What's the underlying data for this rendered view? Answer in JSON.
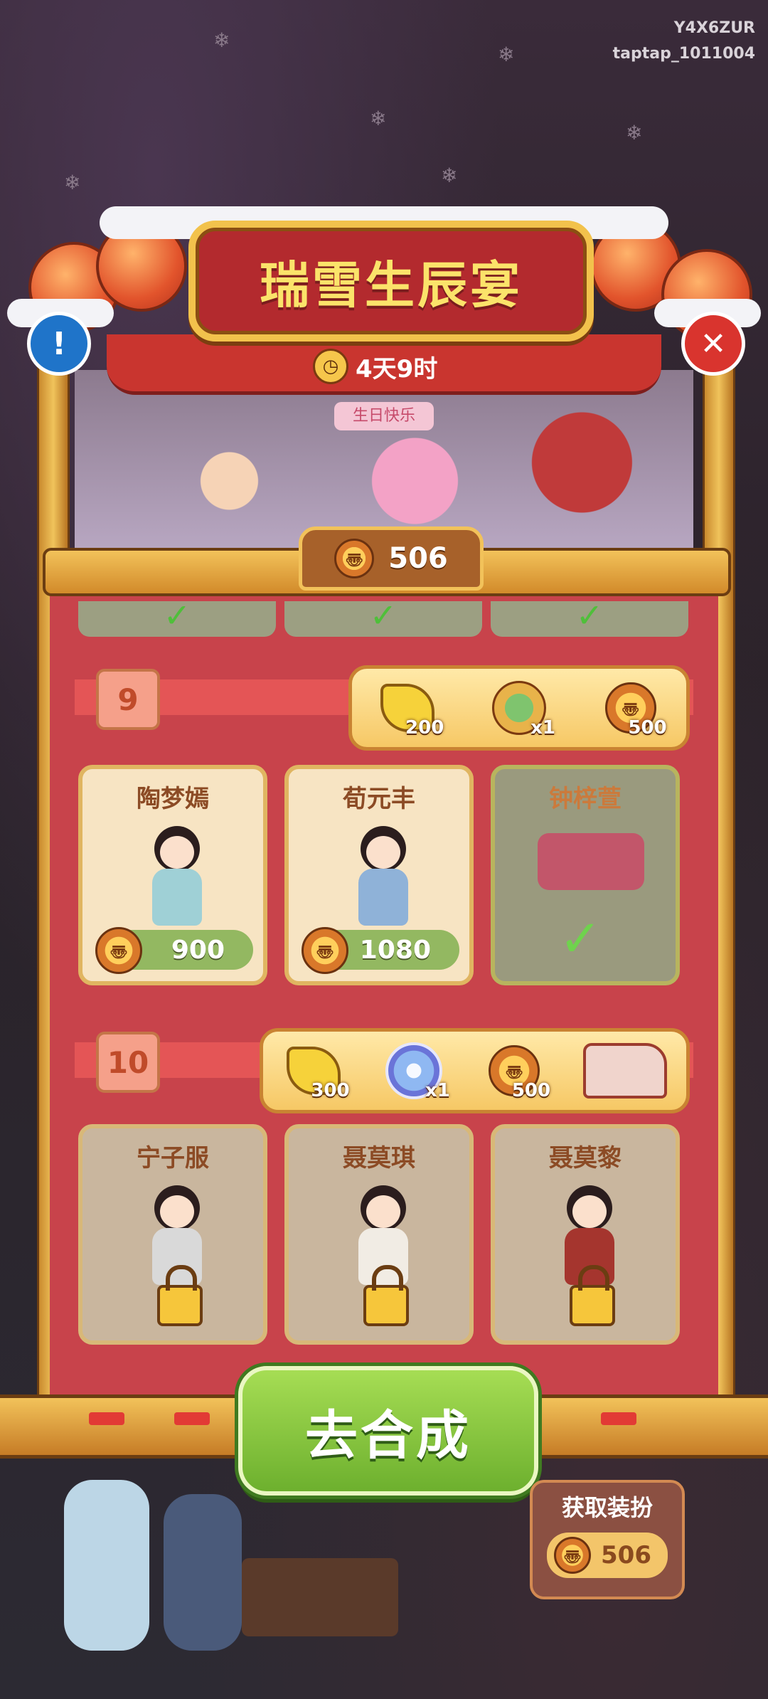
{
  "watermark": {
    "line1": "Y4X6ZUR",
    "line2": "taptap_1011004"
  },
  "event": {
    "title": "瑞雪生辰宴",
    "timer": "4天9时",
    "scene_tag": "生日快乐"
  },
  "currency": {
    "icon": "coin-token-icon",
    "value": "506"
  },
  "buttons": {
    "info": "!",
    "close": "✕",
    "go_label": "去合成"
  },
  "tiers": [
    {
      "level": "9",
      "rewards": [
        {
          "icon": "cloth-icon",
          "count": "200"
        },
        {
          "icon": "gift-bundle-icon",
          "count": "x1"
        },
        {
          "icon": "coin-token-icon",
          "count": "500"
        }
      ],
      "cards": [
        {
          "name": "陶梦嫣",
          "state": "purchasable",
          "price": "900"
        },
        {
          "name": "荀元丰",
          "state": "purchasable",
          "price": "1080"
        },
        {
          "name": "钟梓萱",
          "state": "owned",
          "price": ""
        }
      ]
    },
    {
      "level": "10",
      "rewards": [
        {
          "icon": "cloth-icon",
          "count": "300"
        },
        {
          "icon": "swirl-orb-icon",
          "count": "x1"
        },
        {
          "icon": "coin-token-icon",
          "count": "500"
        },
        {
          "icon": "food-truck-icon",
          "count": ""
        }
      ],
      "cards": [
        {
          "name": "宁子服",
          "state": "locked"
        },
        {
          "name": "聂莫琪",
          "state": "locked"
        },
        {
          "name": "聂莫黎",
          "state": "locked"
        }
      ]
    }
  ],
  "outfit_panel": {
    "label": "获取装扮",
    "value": "506"
  },
  "colors": {
    "frame_gold": "#f2c25a",
    "panel_red": "#c8434b",
    "title_red": "#b32a2e",
    "go_green": "#6db02e",
    "owned_check": "#6fd34d"
  }
}
